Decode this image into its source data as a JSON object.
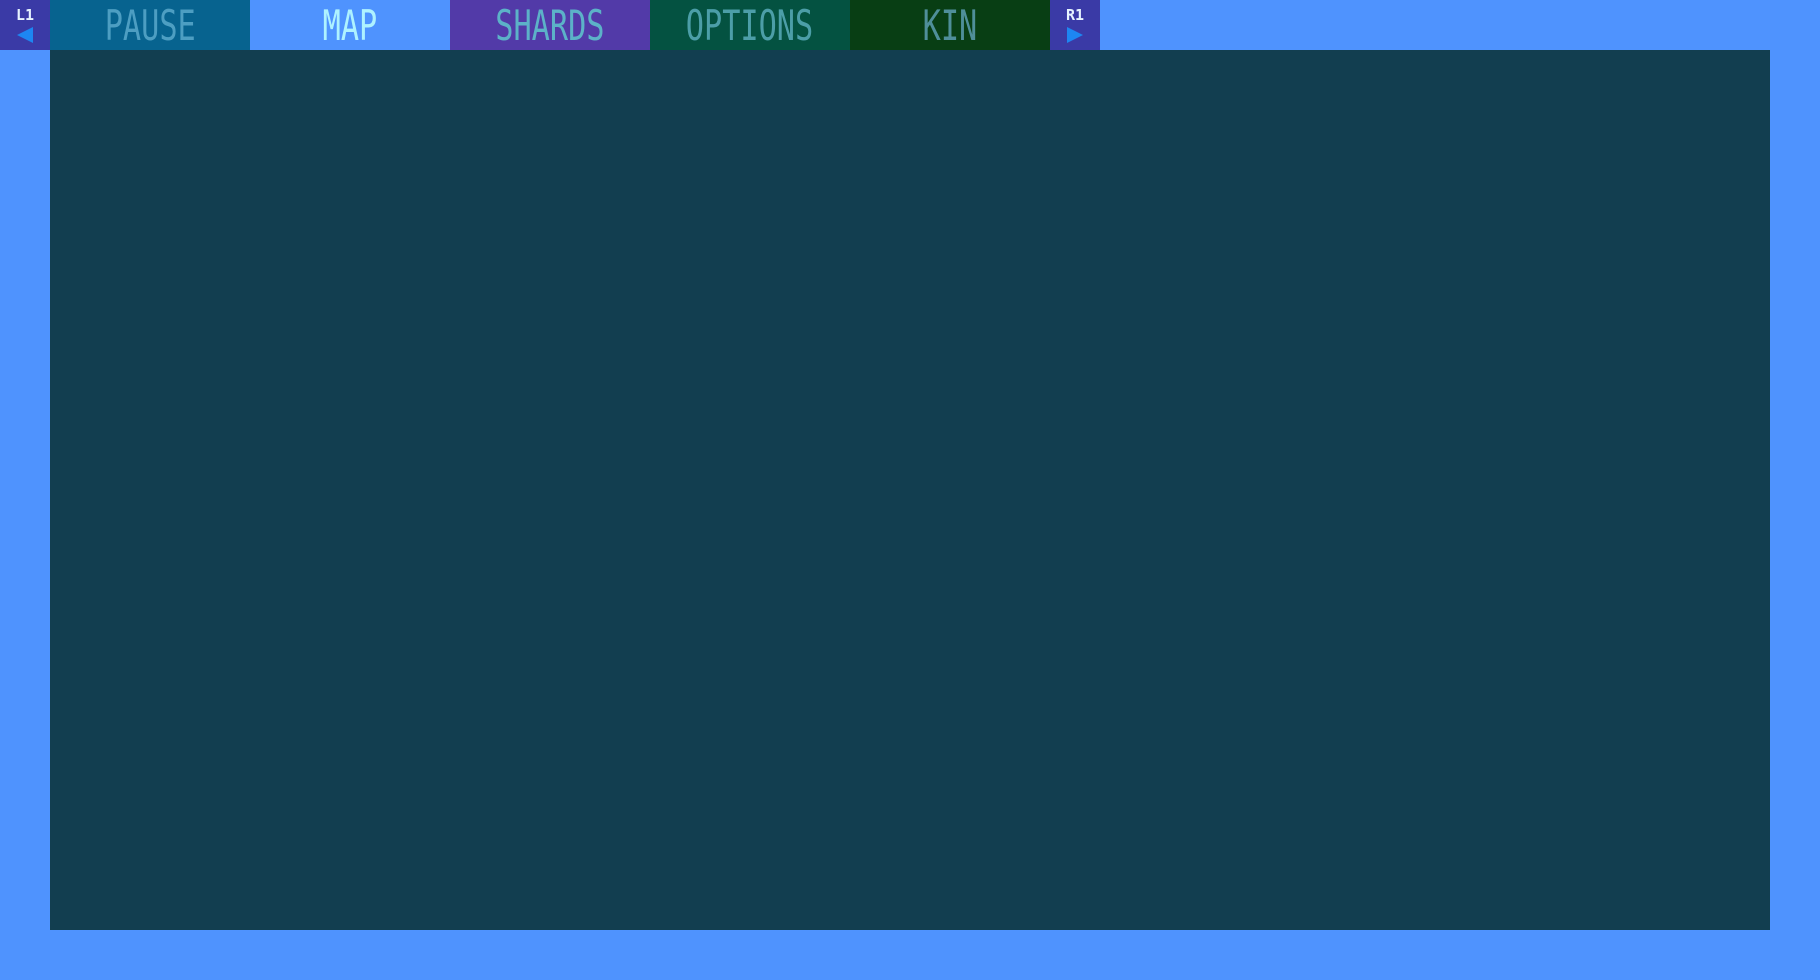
{
  "theme": {
    "background": "#4f93fe",
    "content": "#123e50",
    "shoulder": "#3a3aa6",
    "arrow": "#1d86f2"
  },
  "nav": {
    "left_button": {
      "label": "L1",
      "icon": "left-arrow-icon"
    },
    "right_button": {
      "label": "R1",
      "icon": "right-arrow-icon"
    },
    "tabs": [
      {
        "label": "PAUSE",
        "bg": "#07638f",
        "fg": "#4d9ec2",
        "active": false
      },
      {
        "label": "MAP",
        "bg": "#4f93fe",
        "fg": "#aef2ff",
        "active": true
      },
      {
        "label": "SHARDS",
        "bg": "#523aa8",
        "fg": "#5cb2c8",
        "active": false
      },
      {
        "label": "OPTIONS",
        "bg": "#045241",
        "fg": "#4c9ea8",
        "active": false
      },
      {
        "label": "KIN",
        "bg": "#083e14",
        "fg": "#4f8f9a",
        "active": false
      }
    ]
  }
}
